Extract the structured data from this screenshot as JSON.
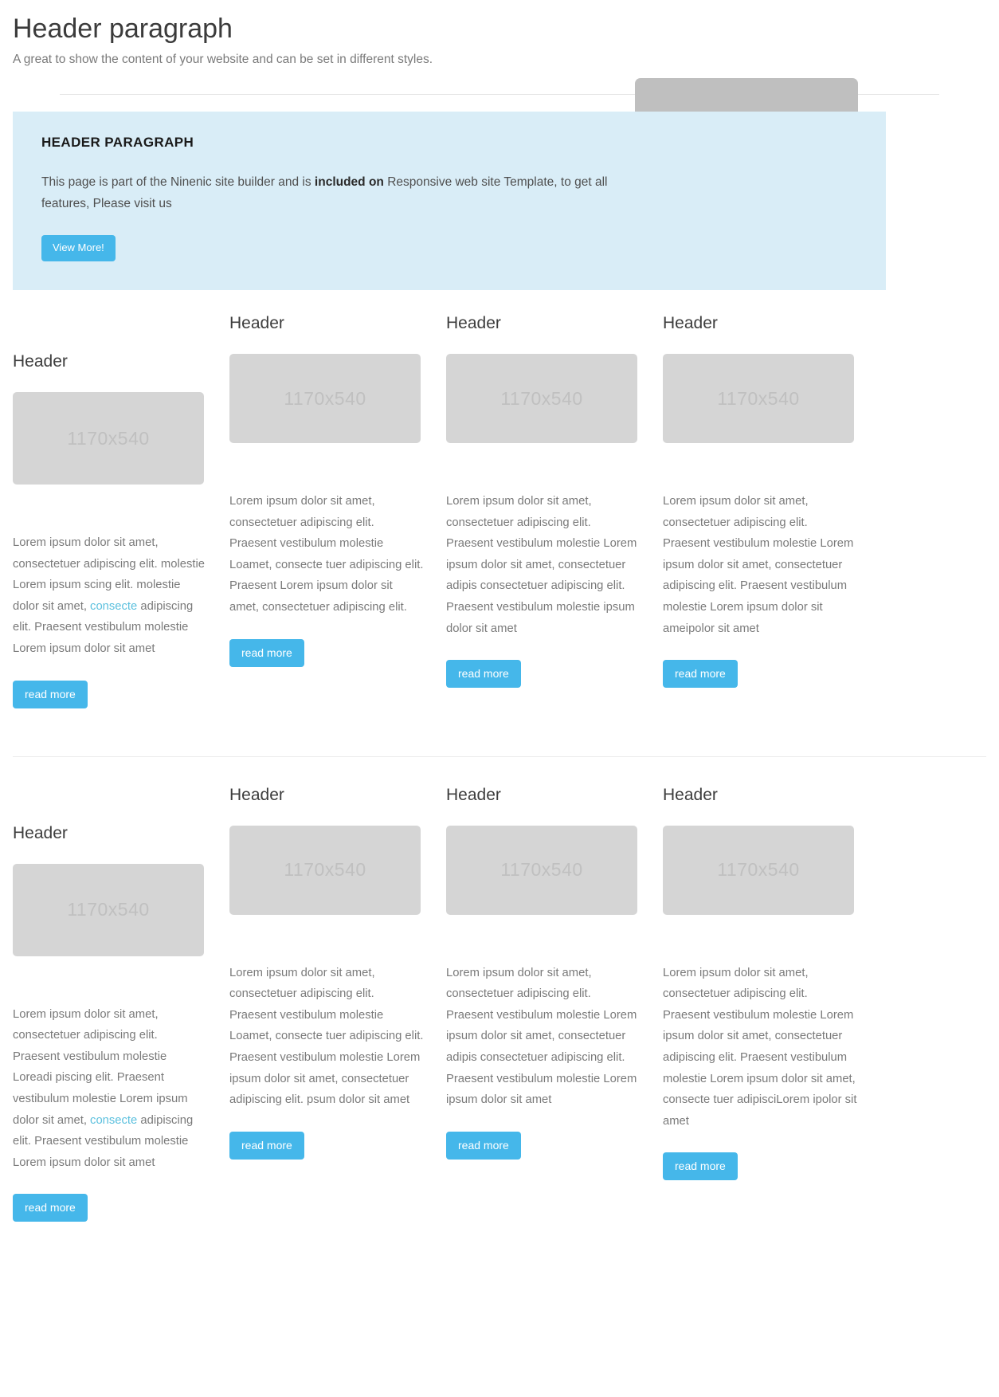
{
  "top": {
    "title": "Header paragraph",
    "subtitle": "A great to show the content of your website and can be set in different styles."
  },
  "banner": {
    "heading": "HEADER PARAGRAPH",
    "text_before": "This page is part of the Ninenic site builder and is ",
    "text_bold": "included on",
    "text_after": " Responsive web site Template, to get all features, Please visit us",
    "button_label": "View More!",
    "bg_color": "#d9edf7",
    "button_color": "#45b7ea"
  },
  "placeholder_label": "1170x540",
  "read_more_label": "read more",
  "link_color": "#5bc0de",
  "rows": [
    {
      "cards": [
        {
          "header": "Header",
          "thumb": "1170x540",
          "text_parts": [
            {
              "type": "text",
              "value": "Lorem ipsum dolor sit amet, consectetuer adipiscing elit. molestie Lorem ipsum scing elit. molestie dolor sit amet, "
            },
            {
              "type": "link",
              "value": "consecte"
            },
            {
              "type": "text",
              "value": "  adipiscing elit. Praesent vestibulum molestie Lorem ipsum dolor sit amet"
            }
          ],
          "button_label": "read more"
        },
        {
          "header": "Header",
          "thumb": "1170x540",
          "text_parts": [
            {
              "type": "text",
              "value": "Lorem ipsum dolor sit amet, consectetuer adipiscing elit. Praesent vestibulum molestie Loamet, consecte tuer adipiscing elit. Praesent Lorem ipsum dolor sit amet, consectetuer adipiscing elit."
            }
          ],
          "button_label": "read more"
        },
        {
          "header": "Header",
          "thumb": "1170x540",
          "text_parts": [
            {
              "type": "text",
              "value": "Lorem ipsum dolor sit amet, consectetuer adipiscing elit. Praesent vestibulum molestie Lorem ipsum dolor sit amet, consectetuer adipis consectetuer adipiscing elit. Praesent vestibulum molestie ipsum dolor sit amet"
            }
          ],
          "button_label": "read more"
        },
        {
          "header": "Header",
          "thumb": "1170x540",
          "text_parts": [
            {
              "type": "text",
              "value": "Lorem ipsum dolor sit amet, consectetuer adipiscing elit. Praesent vestibulum molestie Lorem ipsum dolor sit amet, consectetuer adipiscing elit. Praesent vestibulum molestie Lorem ipsum dolor sit ameipolor sit amet"
            }
          ],
          "button_label": "read more"
        }
      ]
    },
    {
      "cards": [
        {
          "header": "Header",
          "thumb": "1170x540",
          "text_parts": [
            {
              "type": "text",
              "value": "Lorem ipsum dolor sit amet, consectetuer adipiscing elit. Praesent vestibulum molestie Loreadi piscing elit. Praesent vestibulum molestie Lorem ipsum dolor sit amet, "
            },
            {
              "type": "link",
              "value": "consecte"
            },
            {
              "type": "text",
              "value": " adipiscing elit. Praesent vestibulum molestie Lorem ipsum dolor sit amet"
            }
          ],
          "button_label": "read more"
        },
        {
          "header": "Header",
          "thumb": "1170x540",
          "text_parts": [
            {
              "type": "text",
              "value": "Lorem ipsum dolor sit amet, consectetuer adipiscing elit. Praesent vestibulum molestie Loamet, consecte tuer adipiscing elit. Praesent vestibulum molestie Lorem ipsum dolor sit amet, consectetuer adipiscing elit. psum dolor sit amet"
            }
          ],
          "button_label": "read more"
        },
        {
          "header": "Header",
          "thumb": "1170x540",
          "text_parts": [
            {
              "type": "text",
              "value": "Lorem ipsum dolor sit amet, consectetuer adipiscing elit. Praesent vestibulum molestie Lorem ipsum dolor sit amet, consectetuer adipis consectetuer adipiscing elit. Praesent vestibulum molestie Lorem ipsum dolor sit amet"
            }
          ],
          "button_label": "read more"
        },
        {
          "header": "Header",
          "thumb": "1170x540",
          "text_parts": [
            {
              "type": "text",
              "value": "Lorem ipsum dolor sit amet, consectetuer adipiscing elit. Praesent vestibulum molestie Lorem ipsum dolor sit amet, consectetuer adipiscing elit. Praesent vestibulum molestie Lorem ipsum dolor sit amet, consecte tuer adipisciLorem ipolor sit amet"
            }
          ],
          "button_label": "read more"
        }
      ]
    }
  ]
}
